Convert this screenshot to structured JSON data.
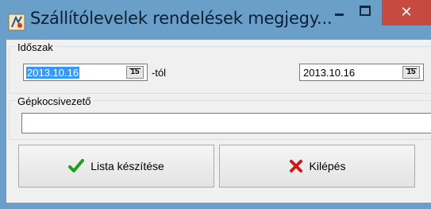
{
  "window": {
    "title": "Szállítólevelek rendelések megjegy...",
    "icons": {
      "app": "app-icon",
      "minimize": "minimize-icon",
      "maximize": "maximize-icon",
      "close": "close-icon"
    },
    "close_glyph": "✕"
  },
  "period": {
    "label": "Időszak",
    "from_date": "2013.10.16",
    "from_suffix": "-tól",
    "to_date": "2013.10.16",
    "calendar_glyph": "15"
  },
  "driver": {
    "label": "Gépkocsivezető",
    "value": ""
  },
  "buttons": {
    "list": {
      "label": "Lista készítése",
      "icon": "checkmark-icon"
    },
    "exit": {
      "label": "Kilépés",
      "icon": "red-x-icon"
    }
  },
  "colors": {
    "titlebar": "#6a9fc9",
    "close": "#c74a40",
    "selection": "#3399ff",
    "check": "#1e9e1e",
    "x": "#cc1a1a"
  }
}
